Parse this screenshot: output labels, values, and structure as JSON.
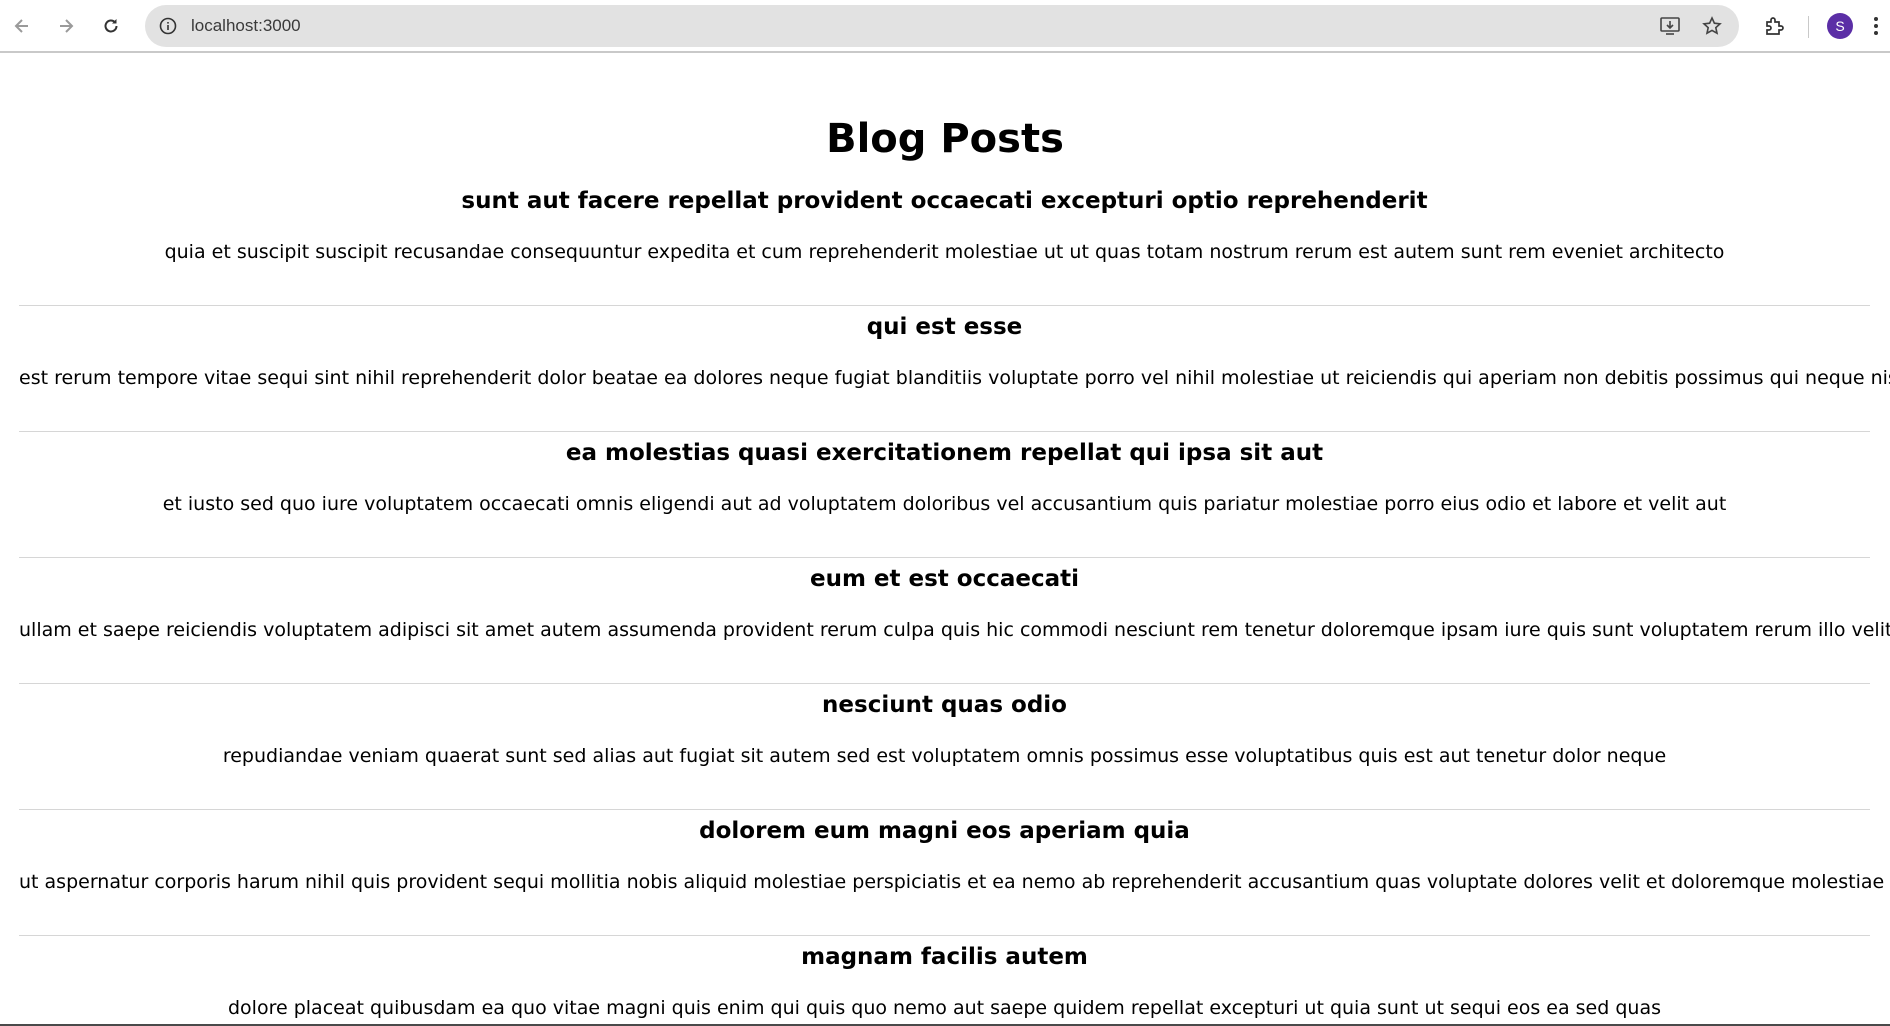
{
  "browser": {
    "url": "localhost:3000",
    "avatar_letter": "S",
    "avatar_color": "#5b2ea6"
  },
  "page": {
    "title": "Blog Posts",
    "posts": [
      {
        "title": "sunt aut facere repellat provident occaecati excepturi optio reprehenderit",
        "body": "quia et suscipit suscipit recusandae consequuntur expedita et cum reprehenderit molestiae ut ut quas totam nostrum rerum est autem sunt rem eveniet architecto"
      },
      {
        "title": "qui est esse",
        "body": "est rerum tempore vitae sequi sint nihil reprehenderit dolor beatae ea dolores neque fugiat blanditiis voluptate porro vel nihil molestiae ut reiciendis qui aperiam non debitis possimus qui neque nisi nulla"
      },
      {
        "title": "ea molestias quasi exercitationem repellat qui ipsa sit aut",
        "body": "et iusto sed quo iure voluptatem occaecati omnis eligendi aut ad voluptatem doloribus vel accusantium quis pariatur molestiae porro eius odio et labore et velit aut"
      },
      {
        "title": "eum et est occaecati",
        "body": "ullam et saepe reiciendis voluptatem adipisci sit amet autem assumenda provident rerum culpa quis hic commodi nesciunt rem tenetur doloremque ipsam iure quis sunt voluptatem rerum illo velit"
      },
      {
        "title": "nesciunt quas odio",
        "body": "repudiandae veniam quaerat sunt sed alias aut fugiat sit autem sed est voluptatem omnis possimus esse voluptatibus quis est aut tenetur dolor neque"
      },
      {
        "title": "dolorem eum magni eos aperiam quia",
        "body": "ut aspernatur corporis harum nihil quis provident sequi mollitia nobis aliquid molestiae perspiciatis et ea nemo ab reprehenderit accusantium quas voluptate dolores velit et doloremque molestiae"
      },
      {
        "title": "magnam facilis autem",
        "body": "dolore placeat quibusdam ea quo vitae magni quis enim qui quis quo nemo aut saepe quidem repellat excepturi ut quia sunt ut sequi eos ea sed quas"
      }
    ]
  }
}
